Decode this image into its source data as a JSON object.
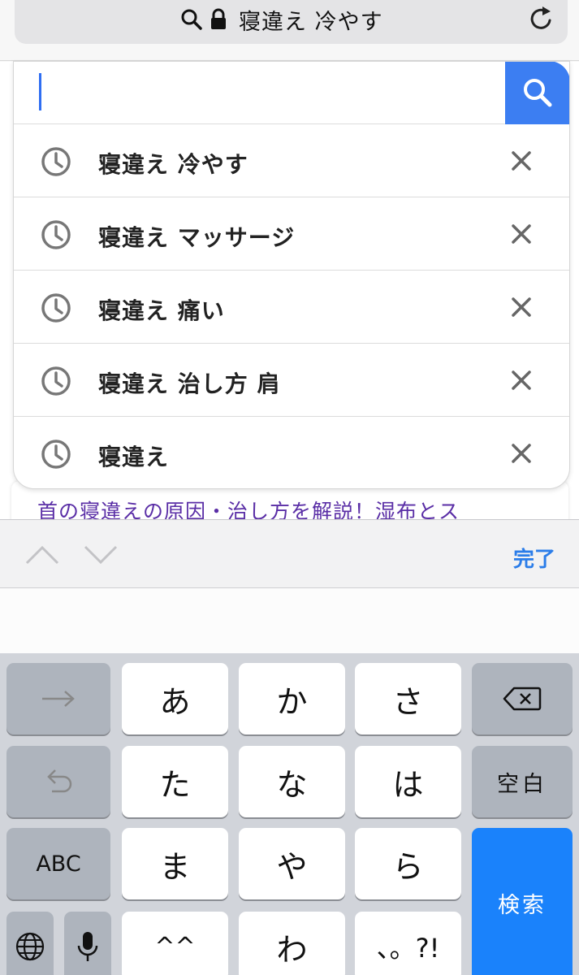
{
  "address_bar": {
    "url_text": "寝違え 冷やす",
    "search_icon": "search-icon",
    "lock_icon": "lock-icon",
    "reload_icon": "reload-icon"
  },
  "search": {
    "input_value": "",
    "button_icon": "search-icon"
  },
  "suggestions": [
    {
      "label": "寝違え 冷やす",
      "icon": "clock-icon",
      "remove_icon": "close-icon"
    },
    {
      "label": "寝違え マッサージ",
      "icon": "clock-icon",
      "remove_icon": "close-icon"
    },
    {
      "label": "寝違え 痛い",
      "icon": "clock-icon",
      "remove_icon": "close-icon"
    },
    {
      "label": "寝違え 治し方 肩",
      "icon": "clock-icon",
      "remove_icon": "close-icon"
    },
    {
      "label": "寝違え",
      "icon": "clock-icon",
      "remove_icon": "close-icon"
    }
  ],
  "page": {
    "result_link": "首の寝違えの原因・治し方を解説！湿布とス"
  },
  "toolbar": {
    "done_label": "完了",
    "prev_icon": "chevron-up-icon",
    "next_icon": "chevron-down-icon"
  },
  "keyboard": {
    "keys": {
      "a": "あ",
      "ka": "か",
      "sa": "さ",
      "ta": "た",
      "na": "な",
      "ha": "は",
      "ma": "ま",
      "ya": "や",
      "ra": "ら",
      "face": "^^",
      "wa": "わ",
      "punct": "、。?!"
    },
    "space_label": "空白",
    "abc_label": "ABC",
    "search_label": "検索",
    "next_icon": "arrow-right-icon",
    "undo_icon": "undo-icon",
    "delete_icon": "delete-icon",
    "globe_icon": "globe-icon",
    "mic_icon": "microphone-icon"
  },
  "colors": {
    "accent_blue": "#1a82fb",
    "search_button": "#3c7ef2",
    "link_purple": "#5a2ea6"
  }
}
